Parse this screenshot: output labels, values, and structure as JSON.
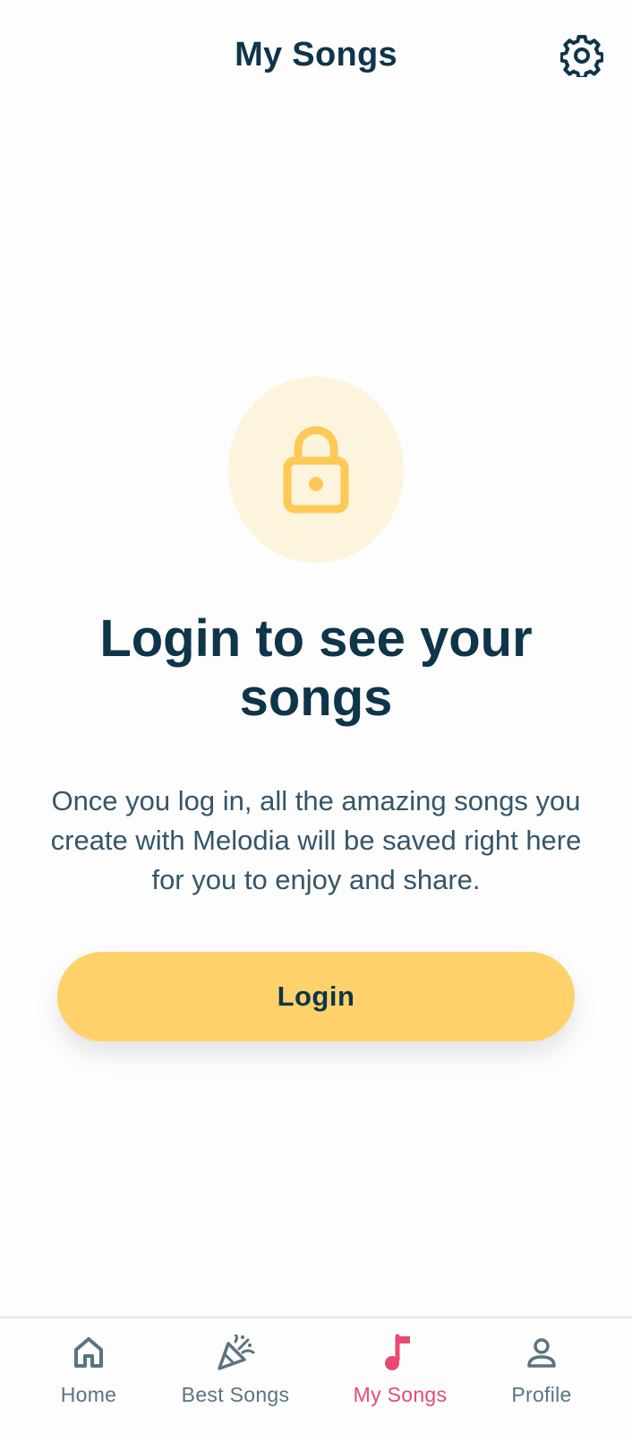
{
  "header": {
    "title": "My Songs",
    "settings_icon": "gear-icon"
  },
  "main": {
    "lock_icon": "lock-icon",
    "headline": "Login to see your songs",
    "description": "Once you log in, all the amazing songs you create with Melodia will be saved right here for you to enjoy and share.",
    "login_label": "Login"
  },
  "nav": {
    "items": [
      {
        "label": "Home",
        "icon": "home-icon",
        "active": false
      },
      {
        "label": "Best Songs",
        "icon": "party-popper-icon",
        "active": false
      },
      {
        "label": "My Songs",
        "icon": "music-note-icon",
        "active": true
      },
      {
        "label": "Profile",
        "icon": "user-icon",
        "active": false
      }
    ]
  },
  "colors": {
    "primary_text": "#0e3549",
    "accent_yellow": "#fed16a",
    "lock_bg": "#fdf4dd",
    "active_nav": "#e84a72",
    "inactive_nav": "#5a7481"
  }
}
